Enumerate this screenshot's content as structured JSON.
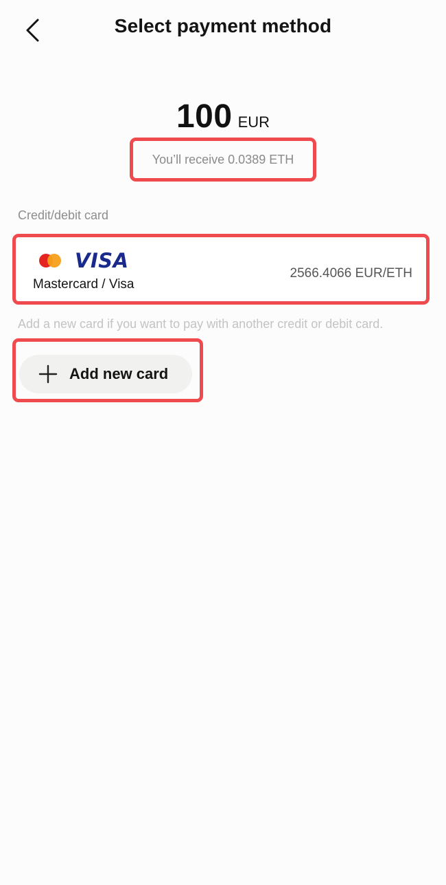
{
  "header": {
    "title": "Select payment method",
    "back_icon": "chevron-left-icon"
  },
  "amount": {
    "value": "100",
    "currency": "EUR",
    "receive_text": "You’ll receive 0.0389 ETH"
  },
  "payment_section": {
    "label": "Credit/debit card",
    "card": {
      "brand_logos": [
        "mastercard-logo",
        "visa-logo"
      ],
      "visa_logo_text": "VISA",
      "name": "Mastercard / Visa",
      "rate": "2566.4066 EUR/ETH"
    },
    "hint": "Add a new card if you want to pay with another credit or debit card.",
    "add_button_label": "Add new card",
    "add_icon": "plus-icon"
  },
  "colors": {
    "highlight": "#ef4b4f",
    "visa_blue": "#1a2a8c",
    "mastercard_red": "#e52421",
    "mastercard_orange": "#f5a01a",
    "button_bg": "#f1f1f0"
  }
}
